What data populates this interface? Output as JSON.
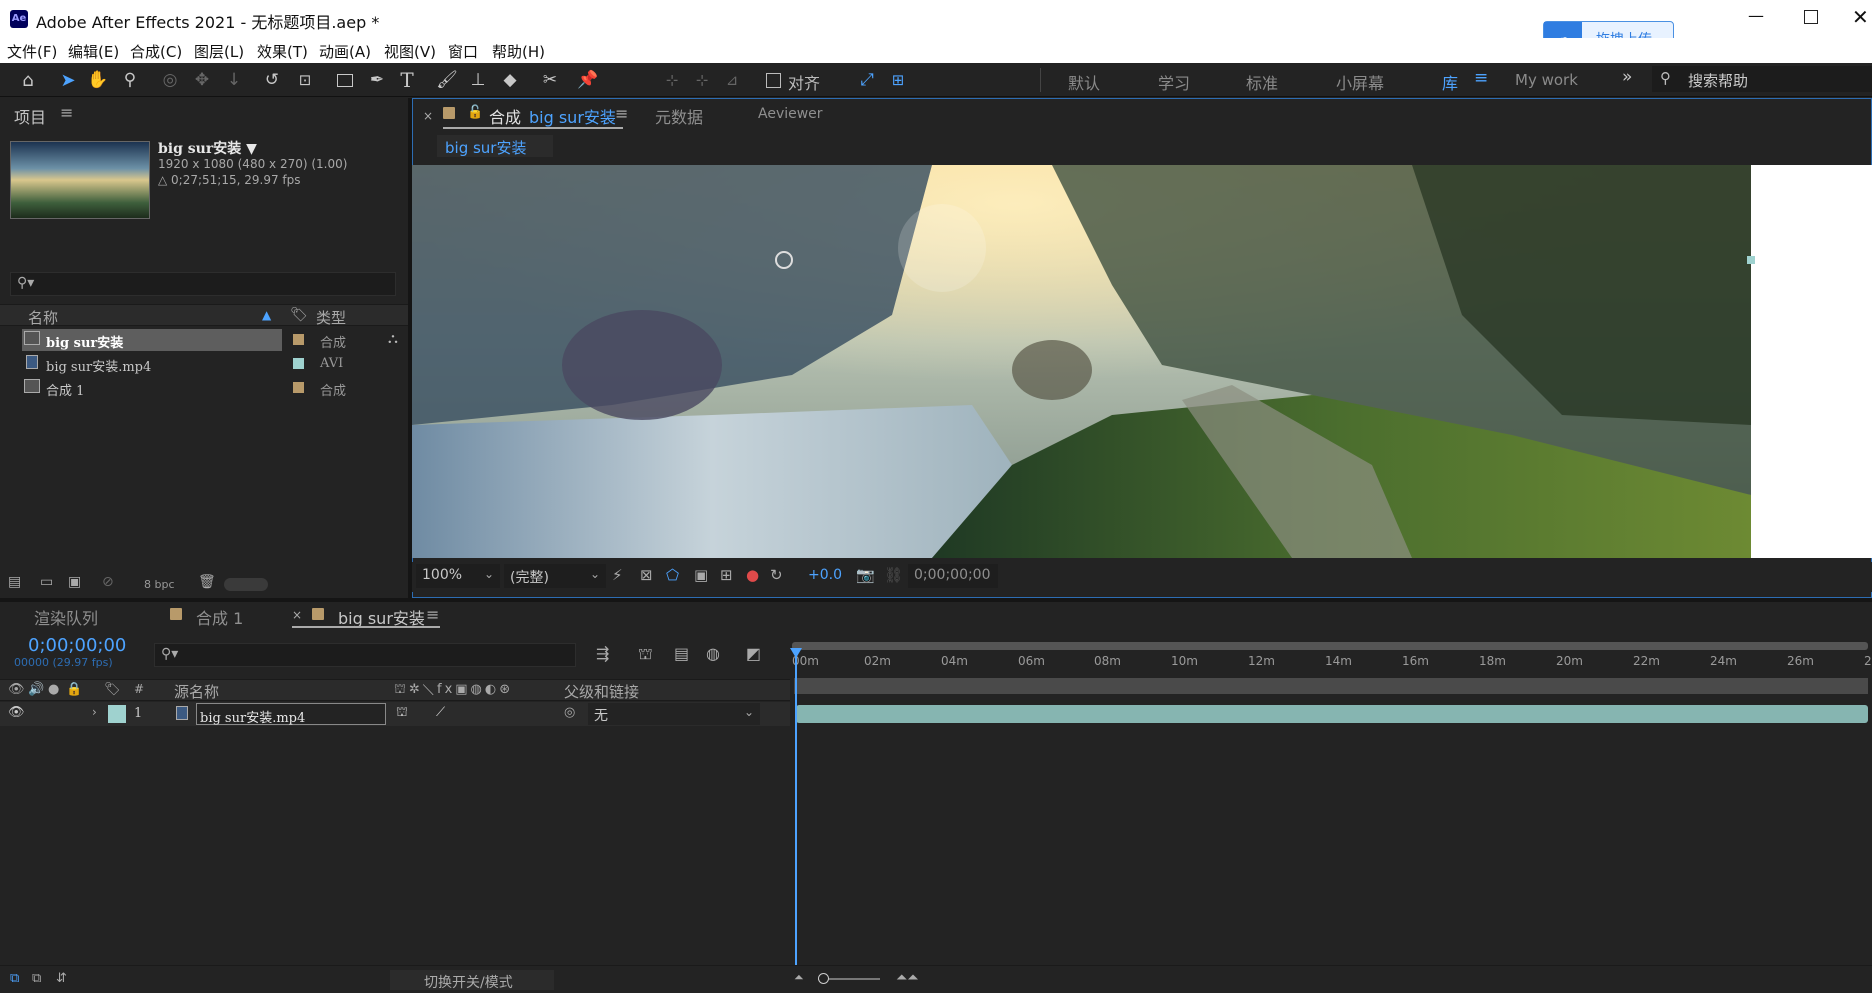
{
  "window": {
    "title": "Adobe After Effects 2021 - 无标题项目.aep *",
    "app_icon": "Ae",
    "upload_button": "拖拽上传"
  },
  "menu": [
    "文件(F)",
    "编辑(E)",
    "合成(C)",
    "图层(L)",
    "效果(T)",
    "动画(A)",
    "视图(V)",
    "窗口",
    "帮助(H)"
  ],
  "toolbar": {
    "align_label": "对齐",
    "workspaces": [
      "默认",
      "学习",
      "标准",
      "小屏幕",
      "库"
    ],
    "mywork": "My work",
    "search_placeholder": "搜索帮助"
  },
  "project_panel": {
    "title": "项目",
    "selected_name": "big sur安装 ▼",
    "selected_info_1": "1920 x 1080  (480 x 270) (1.00)",
    "selected_info_2": "△ 0;27;51;15, 29.97 fps",
    "col_name": "名称",
    "col_type": "类型",
    "items": [
      {
        "name": "big sur安装",
        "type": "合成",
        "label_color": "#b89a6a"
      },
      {
        "name": "big sur安装.mp4",
        "type": "AVI",
        "label_color": "#9fd2cf"
      },
      {
        "name": "合成 1",
        "type": "合成",
        "label_color": "#b89a6a"
      }
    ],
    "bpc": "8 bpc"
  },
  "comp_panel": {
    "tab_prefix": "合成",
    "tab_name": "big sur安装",
    "tab_metadata": "元数据",
    "tab_aeviewer": "Aeviewer",
    "breadcrumb": "big sur安装",
    "zoom": "100%",
    "resolution": "(完整)",
    "exposure": "+0.0",
    "timecode": "0;00;00;00"
  },
  "timeline": {
    "tabs": [
      "渲染队列",
      "合成 1",
      "big sur安装"
    ],
    "current_time": "0;00;00;00",
    "frame_info": "00000 (29.97 fps)",
    "col_source": "源名称",
    "col_parent": "父级和链接",
    "layer": {
      "index": "1",
      "name": "big sur安装.mp4",
      "parent": "无",
      "label_color": "#9fd2cf"
    },
    "ticks": [
      "00m",
      "02m",
      "04m",
      "06m",
      "08m",
      "10m",
      "12m",
      "14m",
      "16m",
      "18m",
      "20m",
      "22m",
      "24m",
      "26m",
      "2"
    ],
    "toggle_label": "切换开关/模式"
  }
}
